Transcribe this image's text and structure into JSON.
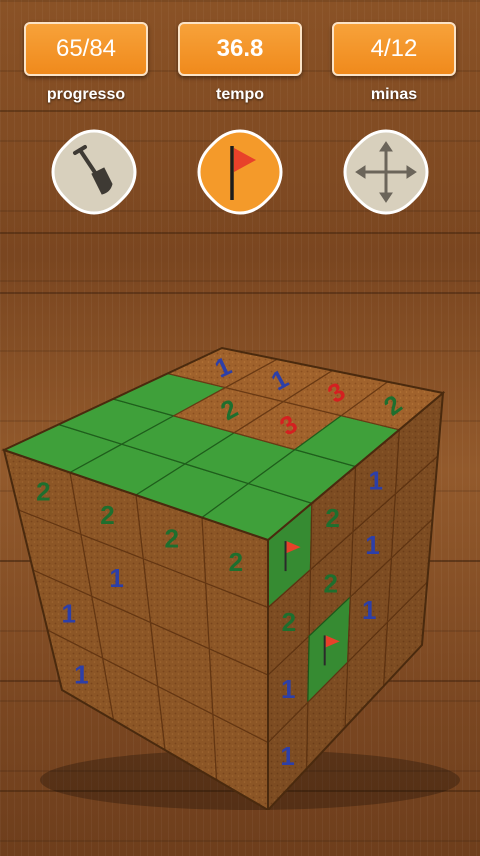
{
  "stats": {
    "progress": {
      "value": "65/84",
      "label": "progresso"
    },
    "time": {
      "value": "36.8",
      "label": "tempo"
    },
    "mines": {
      "value": "4/12",
      "label": "minas"
    }
  },
  "tools": [
    {
      "name": "dig-tool",
      "icon": "shovel-icon",
      "active": false
    },
    {
      "name": "flag-tool",
      "icon": "flag-icon",
      "active": true
    },
    {
      "name": "move-tool",
      "icon": "move-arrows-icon",
      "active": false
    }
  ],
  "colors": {
    "accent_orange": "#f08a1c",
    "dirt": "#a0622c",
    "grass": "#3fa03a",
    "number_1": "#2d3fa8",
    "number_2": "#1e6f2e",
    "number_3": "#d42020",
    "flag": "#e8412a"
  },
  "cube": {
    "grid_size": 4,
    "top": [
      [
        "g",
        "g",
        "g",
        "1"
      ],
      [
        "g",
        "g",
        "2",
        "1"
      ],
      [
        "g",
        "g",
        "3",
        "3"
      ],
      [
        "g",
        "g",
        "g",
        "2"
      ]
    ],
    "left": [
      [
        "2",
        "2",
        "2",
        "2"
      ],
      [
        "",
        "1",
        "",
        ""
      ],
      [
        "1",
        "",
        "",
        ""
      ],
      [
        "1",
        "",
        "",
        ""
      ]
    ],
    "right": [
      [
        "F",
        "2",
        "1",
        ""
      ],
      [
        "2",
        "2",
        "1",
        ""
      ],
      [
        "1",
        "F",
        "1",
        ""
      ],
      [
        "1",
        "",
        "",
        ""
      ]
    ]
  }
}
